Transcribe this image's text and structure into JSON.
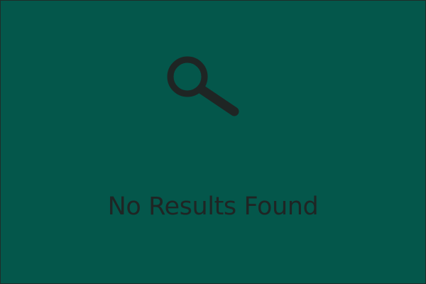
{
  "empty_state": {
    "icon": "search-icon",
    "message": "No Results Found",
    "background_color": "#04574b",
    "foreground_color": "#1f2524"
  }
}
